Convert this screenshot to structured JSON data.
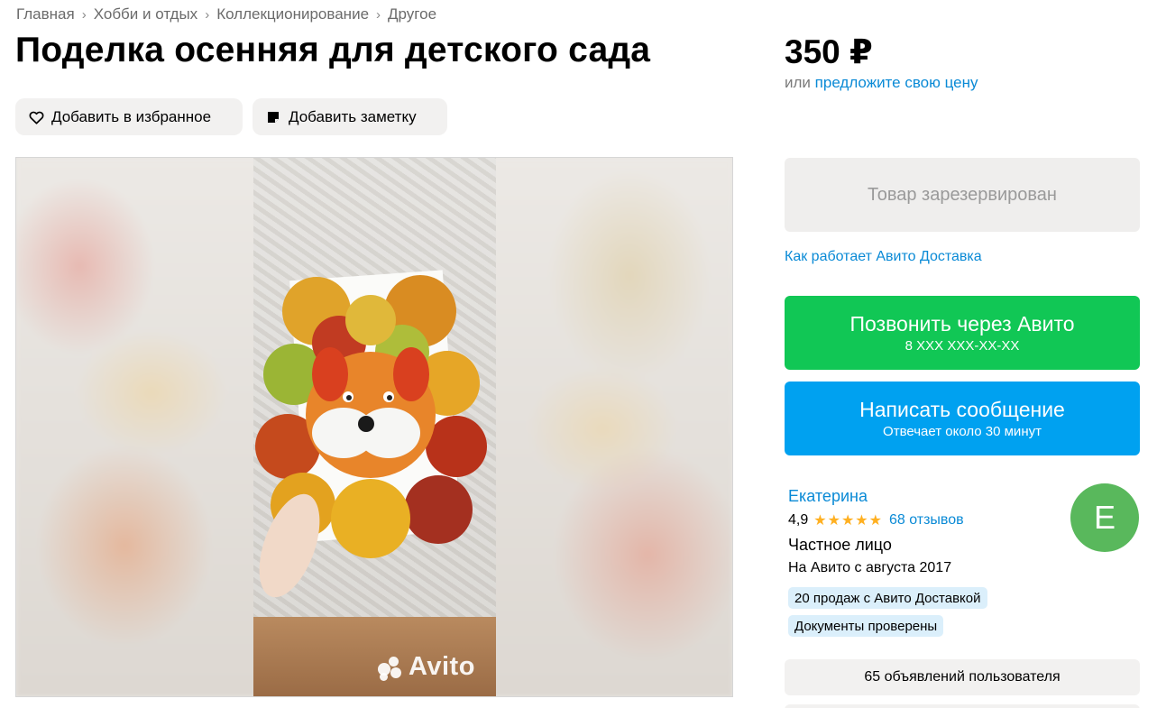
{
  "breadcrumb": [
    "Главная",
    "Хобби и отдых",
    "Коллекционирование",
    "Другое"
  ],
  "title": "Поделка осенняя для детского сада",
  "price": {
    "amount": "350 ₽",
    "offer_prefix": "или",
    "offer_link": "предложите свою цену"
  },
  "actions": {
    "favorite": "Добавить в избранное",
    "note": "Добавить заметку"
  },
  "gallery": {
    "watermark": "Avito"
  },
  "reserved": "Товар зарезервирован",
  "delivery_link": "Как работает Авито Доставка",
  "call": {
    "label": "Позвонить через Авито",
    "phone": "8 XXX XXX-XX-XX"
  },
  "message": {
    "label": "Написать сообщение",
    "reply_time": "Отвечает около 30 минут"
  },
  "seller": {
    "name": "Екатерина",
    "rating": "4,9",
    "stars": "★★★★★",
    "reviews": "68 отзывов",
    "type": "Частное лицо",
    "since": "На Авито с августа 2017",
    "badges": [
      "20 продаж с Авито Доставкой",
      "Документы проверены"
    ],
    "avatar_letter": "Е",
    "avatar_color": "#59b85c"
  },
  "listings": "65 объявлений пользователя",
  "colors": {
    "call": "#11c755",
    "message": "#00a1f0",
    "link": "#0a8ad6",
    "star": "#ffb021"
  },
  "icons": [
    "heart-icon",
    "note-icon",
    "chevron-right-icon"
  ]
}
